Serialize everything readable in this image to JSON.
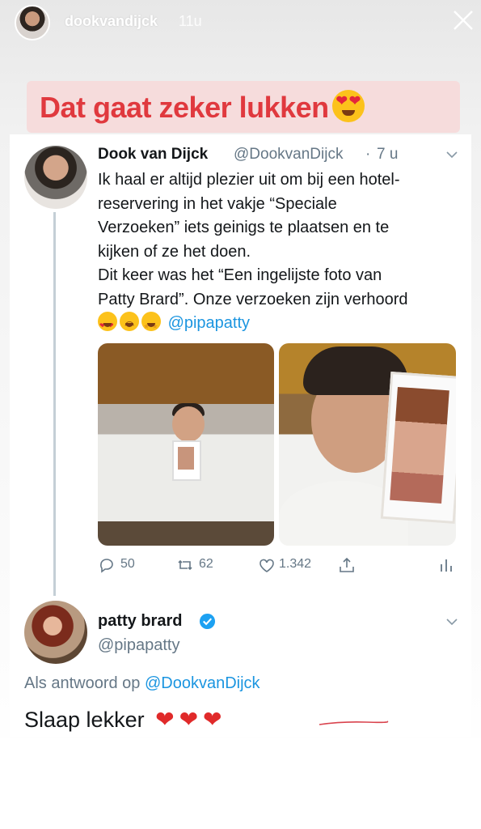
{
  "story": {
    "username": "dookvandijck",
    "time": "11u",
    "caption": "Dat gaat zeker lukken"
  },
  "tweet": {
    "name": "Dook van Dijck",
    "handle": "@DookvanDijck",
    "separator": "·",
    "time": "7 u",
    "lines": [
      "Ik haal er altijd plezier uit om bij een hotel-",
      "reservering in het vakje “Speciale",
      "Verzoeken” iets geinigs te plaatsen en te",
      "kijken of ze het doen.",
      "Dit keer was het “Een ingelijste foto van",
      "Patty Brard”. Onze verzoeken zijn verhoord"
    ],
    "mention": "@pipapatty",
    "actions": {
      "replies": "50",
      "retweets": "62",
      "likes": "1.342"
    }
  },
  "reply": {
    "name": "patty brard",
    "handle": "@pipapatty",
    "context_prefix": "Als antwoord op",
    "context_mention": "@DookvanDijck",
    "text": "Slaap lekker"
  },
  "colors": {
    "caption_text": "#e0393e",
    "caption_bg": "#f6dcdc",
    "link": "#1b95e0",
    "secondary": "#657786",
    "verified": "#1da1f2",
    "heart": "#e02a2a"
  }
}
